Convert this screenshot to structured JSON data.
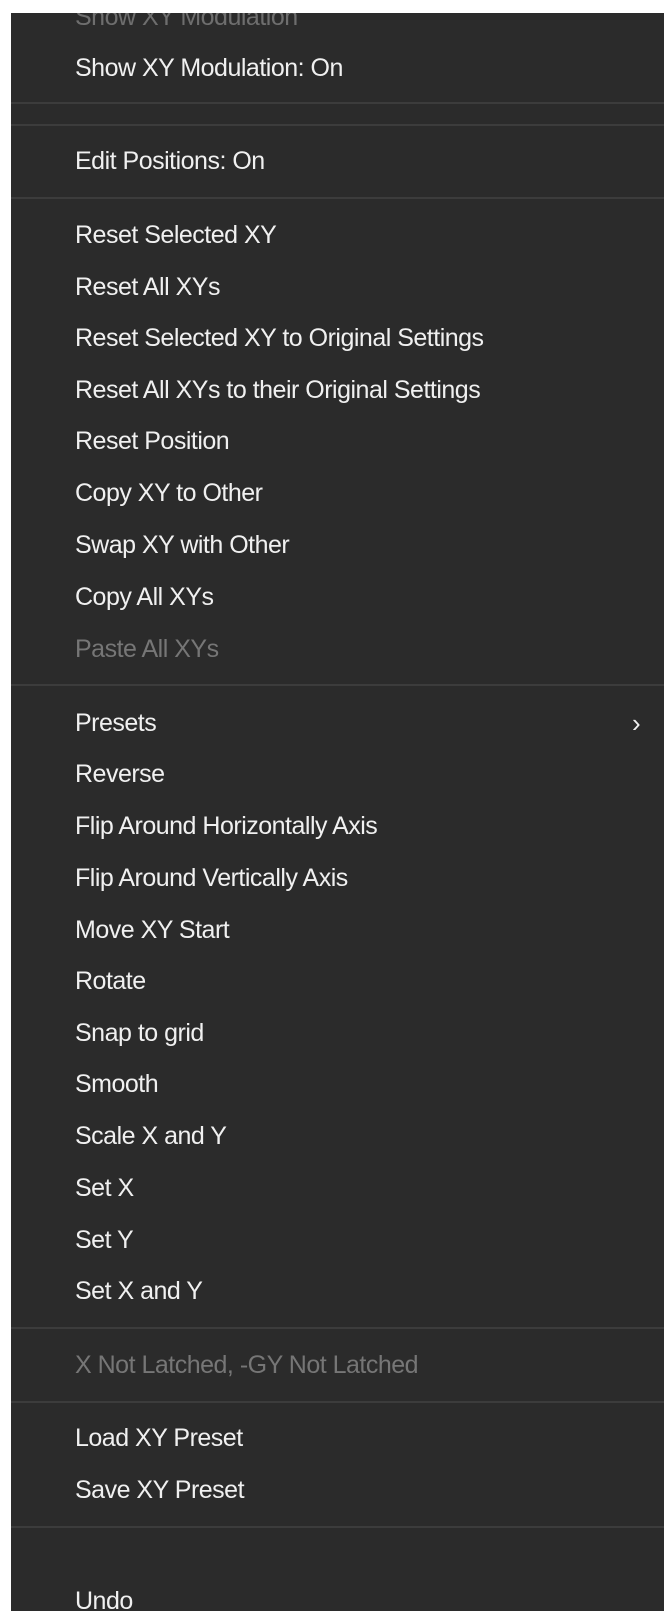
{
  "menu": {
    "partial_top_label": "Show XY Modulation",
    "show_xy_modulation": "Show XY Modulation: On",
    "edit_positions": "Edit Positions: On",
    "reset_selected_xy": "Reset Selected XY",
    "reset_all_xys": "Reset All XYs",
    "reset_selected_xy_original": "Reset Selected XY to Original Settings",
    "reset_all_xys_original": "Reset All XYs to their Original Settings",
    "reset_position": "Reset Position",
    "copy_xy_to_other": "Copy XY to Other",
    "swap_xy_with_other": "Swap XY with Other",
    "copy_all_xys": "Copy All XYs",
    "paste_all_xys": "Paste All XYs",
    "presets": "Presets",
    "presets_chevron": "›",
    "reverse": "Reverse",
    "flip_horizontal": "Flip Around Horizontally Axis",
    "flip_vertical": "Flip Around Vertically Axis",
    "move_xy_start": "Move XY Start",
    "rotate": "Rotate",
    "snap_to_grid": "Snap to grid",
    "smooth": "Smooth",
    "scale_x_and_y": "Scale X and Y",
    "set_x": "Set X",
    "set_y": "Set Y",
    "set_x_and_y": "Set X and Y",
    "latch_status": "X Not Latched, -GY Not Latched",
    "load_xy_preset": "Load XY Preset",
    "save_xy_preset": "Save XY Preset",
    "undo": "Undo"
  },
  "colors": {
    "menu_background": "#2b2b2b",
    "text": "#f0f0f0",
    "disabled_text": "#767676",
    "separator": "#3c3c3c"
  }
}
